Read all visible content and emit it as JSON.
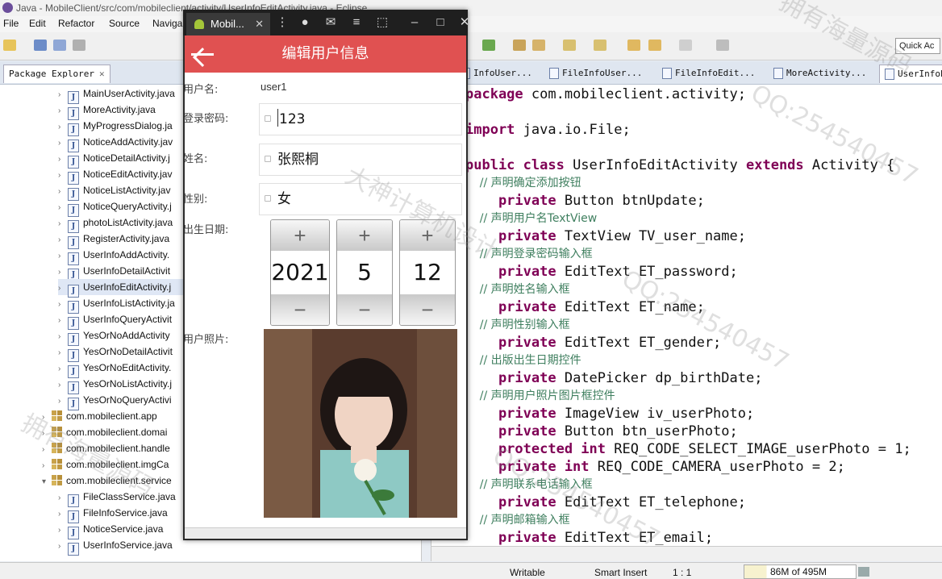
{
  "window": {
    "title": "Java - MobileClient/src/com/mobileclient/activity/UserInfoEditActivity.java - Eclipse"
  },
  "menu": [
    "File",
    "Edit",
    "Refactor",
    "Source",
    "Naviga"
  ],
  "quick_access": "Quick Ac",
  "package_explorer": {
    "tab_label": "Package Explorer",
    "close": "✕",
    "items": [
      {
        "label": "MainUserActivity.java",
        "type": "java",
        "indent": 1
      },
      {
        "label": "MoreActivity.java",
        "type": "java",
        "indent": 1
      },
      {
        "label": "MyProgressDialog.ja",
        "type": "java",
        "indent": 1
      },
      {
        "label": "NoticeAddActivity.jav",
        "type": "java",
        "indent": 1
      },
      {
        "label": "NoticeDetailActivity.j",
        "type": "java",
        "indent": 1
      },
      {
        "label": "NoticeEditActivity.jav",
        "type": "java",
        "indent": 1
      },
      {
        "label": "NoticeListActivity.jav",
        "type": "java",
        "indent": 1
      },
      {
        "label": "NoticeQueryActivity.j",
        "type": "java",
        "indent": 1
      },
      {
        "label": "photoListActivity.java",
        "type": "java",
        "indent": 1
      },
      {
        "label": "RegisterActivity.java",
        "type": "java",
        "indent": 1
      },
      {
        "label": "UserInfoAddActivity.",
        "type": "java",
        "indent": 1
      },
      {
        "label": "UserInfoDetailActivit",
        "type": "java",
        "indent": 1
      },
      {
        "label": "UserInfoEditActivity.j",
        "type": "java",
        "indent": 1,
        "selected": true
      },
      {
        "label": "UserInfoListActivity.ja",
        "type": "java",
        "indent": 1
      },
      {
        "label": "UserInfoQueryActivit",
        "type": "java",
        "indent": 1
      },
      {
        "label": "YesOrNoAddActivity",
        "type": "java",
        "indent": 1
      },
      {
        "label": "YesOrNoDetailActivit",
        "type": "java",
        "indent": 1
      },
      {
        "label": "YesOrNoEditActivity.",
        "type": "java",
        "indent": 1
      },
      {
        "label": "YesOrNoListActivity.j",
        "type": "java",
        "indent": 1
      },
      {
        "label": "YesOrNoQueryActivi",
        "type": "java",
        "indent": 1
      },
      {
        "label": "com.mobileclient.app",
        "type": "pkg",
        "indent": 0
      },
      {
        "label": "com.mobileclient.domai",
        "type": "pkg",
        "indent": 0
      },
      {
        "label": "com.mobileclient.handle",
        "type": "pkg",
        "indent": 0
      },
      {
        "label": "com.mobileclient.imgCa",
        "type": "pkg",
        "indent": 0
      },
      {
        "label": "com.mobileclient.service",
        "type": "pkg",
        "indent": 0,
        "expanded": true
      },
      {
        "label": "FileClassService.java",
        "type": "java",
        "indent": 1
      },
      {
        "label": "FileInfoService.java",
        "type": "java",
        "indent": 1
      },
      {
        "label": "NoticeService.java",
        "type": "java",
        "indent": 1
      },
      {
        "label": "UserInfoService.java",
        "type": "java",
        "indent": 1
      }
    ]
  },
  "editor": {
    "tabs": [
      {
        "label": "InfoUser...",
        "active": false
      },
      {
        "label": "FileInfoUser...",
        "active": false
      },
      {
        "label": "FileInfoEdit...",
        "active": false
      },
      {
        "label": "MoreActivity...",
        "active": false
      },
      {
        "label": "UserInfoE",
        "active": true
      }
    ],
    "lines": [
      {
        "t": "code",
        "kw": "package",
        "rest": " com.mobileclient.activity;"
      },
      {
        "t": "blank"
      },
      {
        "t": "code",
        "kw": "import",
        "rest": " java.io.File;"
      },
      {
        "t": "blank"
      },
      {
        "t": "code",
        "kw": "public class",
        "rest": " UserInfoEditActivity ",
        "kw2": "extends",
        "rest2": " Activity {"
      },
      {
        "t": "comment",
        "text": "    // 声明确定添加按钮"
      },
      {
        "t": "code",
        "kw": "    private",
        "rest": " Button btnUpdate;"
      },
      {
        "t": "comment",
        "text": "    // 声明用户名TextView"
      },
      {
        "t": "code",
        "kw": "    private",
        "rest": " TextView TV_user_name;"
      },
      {
        "t": "comment",
        "text": "    // 声明登录密码输入框"
      },
      {
        "t": "code",
        "kw": "    private",
        "rest": " EditText ET_password;"
      },
      {
        "t": "comment",
        "text": "    // 声明姓名输入框"
      },
      {
        "t": "code",
        "kw": "    private",
        "rest": " EditText ET_name;"
      },
      {
        "t": "comment",
        "text": "    // 声明性别输入框"
      },
      {
        "t": "code",
        "kw": "    private",
        "rest": " EditText ET_gender;"
      },
      {
        "t": "comment",
        "text": "    // 出版出生日期控件"
      },
      {
        "t": "code",
        "kw": "    private",
        "rest": " DatePicker dp_birthDate;"
      },
      {
        "t": "comment",
        "text": "    // 声明用户照片图片框控件"
      },
      {
        "t": "code",
        "kw": "    private",
        "rest": " ImageView iv_userPhoto;"
      },
      {
        "t": "code",
        "kw": "    private",
        "rest": " Button btn_userPhoto;"
      },
      {
        "t": "code",
        "kw": "    protected int",
        "rest": " REQ_CODE_SELECT_IMAGE_userPhoto = 1;"
      },
      {
        "t": "code",
        "kw": "    private int",
        "rest": " REQ_CODE_CAMERA_userPhoto = 2;"
      },
      {
        "t": "comment",
        "text": "    // 声明联系电话输入框"
      },
      {
        "t": "code",
        "kw": "    private",
        "rest": " EditText ET_telephone;"
      },
      {
        "t": "comment",
        "text": "    // 声明邮箱输入框"
      },
      {
        "t": "code",
        "kw": "    private",
        "rest": " EditText ET_email;"
      }
    ]
  },
  "status": {
    "writable": "Writable",
    "insert": "Smart Insert",
    "position": "1 : 1",
    "heap": "86M of 495M"
  },
  "emulator": {
    "tab_label": "Mobil...",
    "close": "✕",
    "app_title": "编辑用户信息",
    "form": {
      "username_label": "用户名:",
      "username_value": "user1",
      "password_label": "登录密码:",
      "password_value": "123",
      "name_label": "姓名:",
      "name_value": "张熙桐",
      "gender_label": "性别:",
      "gender_value": "女",
      "birth_label": "出生日期:",
      "birth_year": "2021",
      "birth_month": "5",
      "birth_day": "12",
      "photo_label": "用户照片:"
    },
    "plus": "+",
    "minus": "−"
  },
  "watermark": [
    "拥有海量源码",
    "QQ:254540457",
    "大神计算机设计",
    "QQ:254540457",
    "拥有海量源码",
    "QQ:254540457"
  ]
}
